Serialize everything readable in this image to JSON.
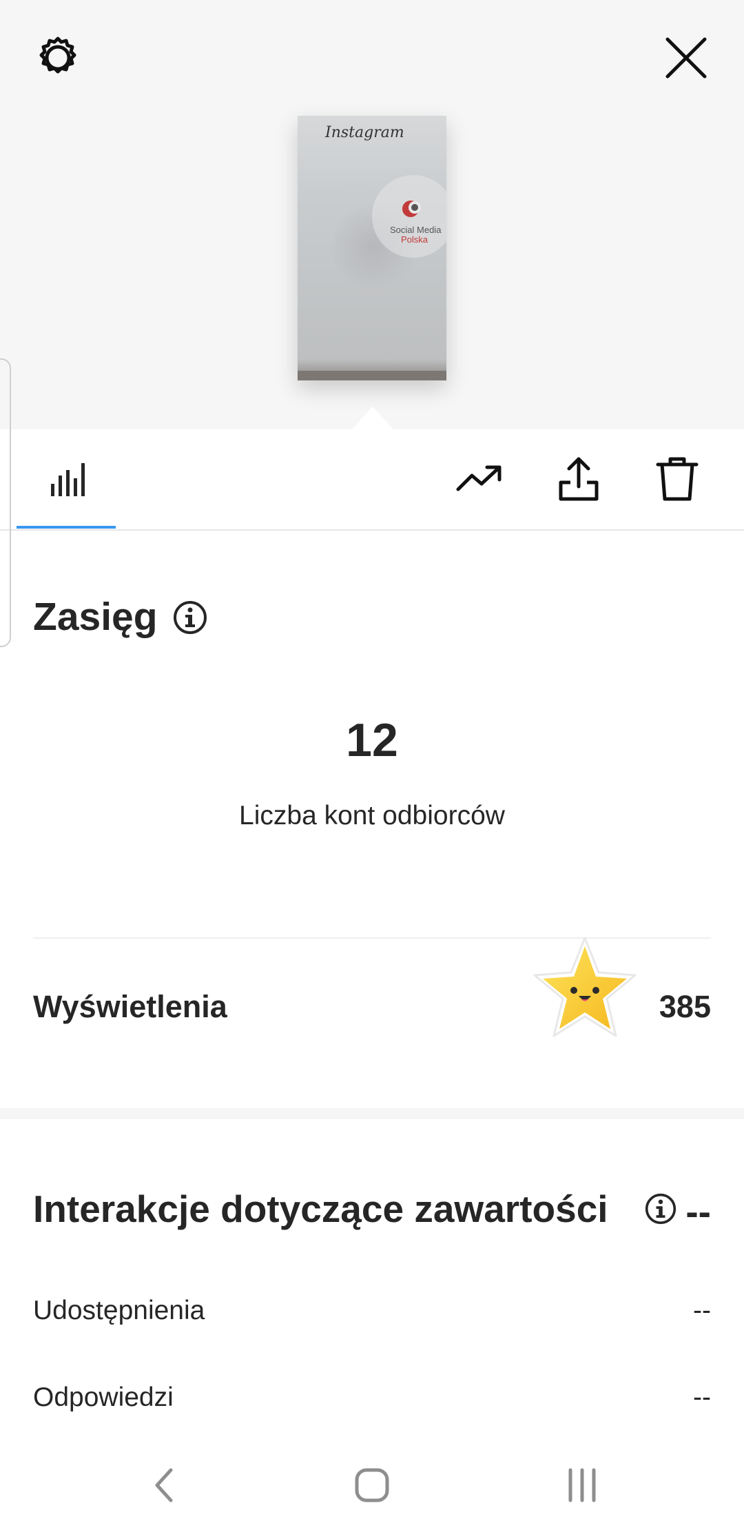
{
  "toolbar": {
    "settings_icon": "gear-icon",
    "close_icon": "close-icon"
  },
  "story_preview": {
    "header_text": "Instagram",
    "brand_line1": "Social Media",
    "brand_line2": "Polska"
  },
  "tabs": {
    "active": "insights",
    "items": [
      {
        "name": "insights",
        "icon": "bar-chart-icon"
      },
      {
        "name": "promote",
        "icon": "trending-up-icon"
      },
      {
        "name": "share",
        "icon": "share-icon"
      },
      {
        "name": "delete",
        "icon": "trash-icon"
      }
    ],
    "accent_color": "#3897f0"
  },
  "reach": {
    "title": "Zasięg",
    "value": "12",
    "caption": "Liczba kont odbiorców"
  },
  "impressions": {
    "label": "Wyświetlenia",
    "value": "385"
  },
  "interactions": {
    "title": "Interakcje dotyczące zawartości",
    "value": "--",
    "rows": [
      {
        "label": "Udostępnienia",
        "value": "--"
      },
      {
        "label": "Odpowiedzi",
        "value": "--"
      }
    ]
  },
  "system_nav": {
    "back_icon": "back-chevron-icon",
    "home_icon": "home-icon",
    "recents_icon": "recents-icon"
  }
}
